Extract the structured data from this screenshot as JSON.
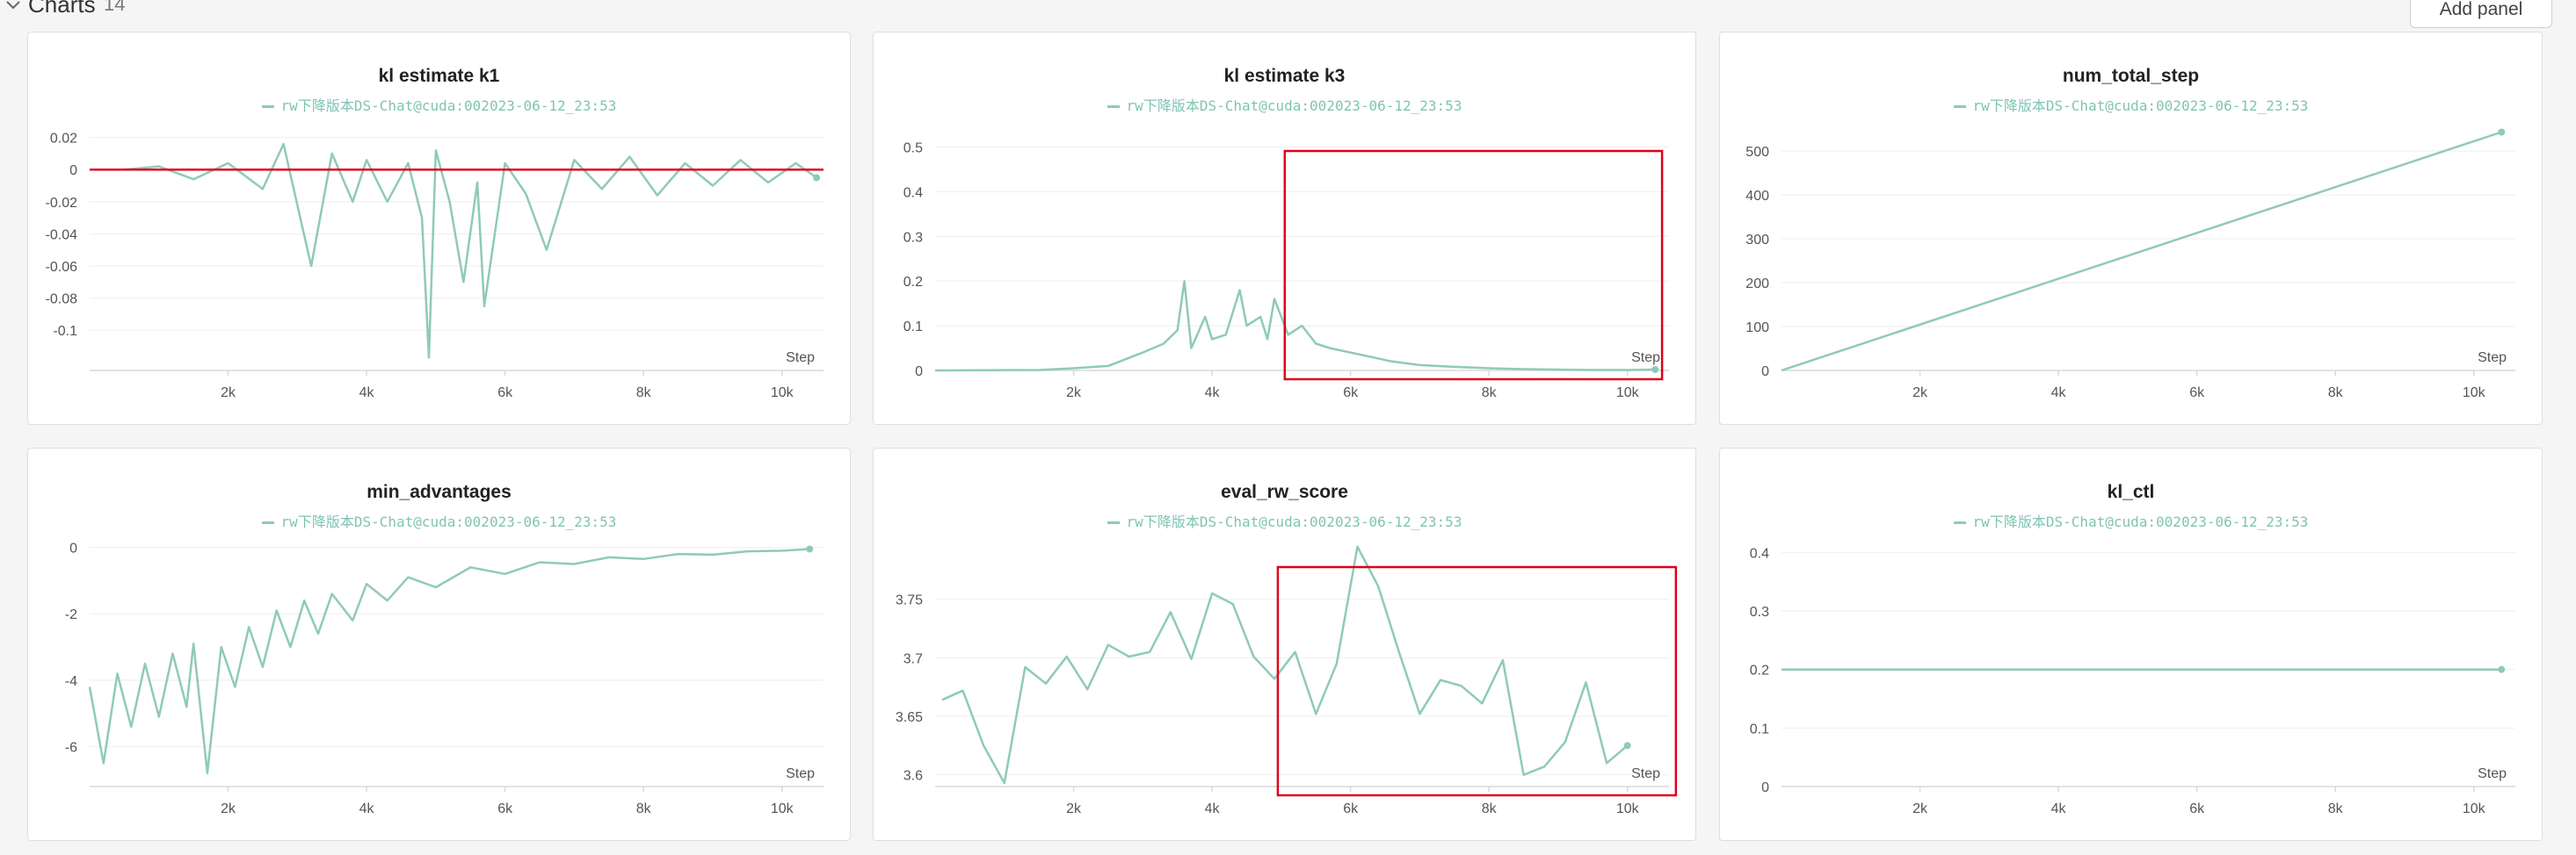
{
  "section": {
    "title": "Charts",
    "count": "14",
    "add_panel_label": "Add panel"
  },
  "legend_label": "rw下降版本DS-Chat@cuda:002023-06-12_23:53",
  "colors": {
    "series": "#8fcab9",
    "annotation_line": "#e0001b",
    "highlight_box": "#e0001b",
    "axis": "#d9d9d9",
    "tick_text": "#555555"
  },
  "chart_data": [
    {
      "id": "kl_k1",
      "type": "line",
      "title": "kl estimate k1",
      "series": [
        {
          "name": "rw下降版本DS-Chat@cuda:002023-06-12_23:53",
          "points": [
            [
              500,
              0
            ],
            [
              1000,
              0.002
            ],
            [
              1500,
              -0.006
            ],
            [
              2000,
              0.004
            ],
            [
              2500,
              -0.012
            ],
            [
              2800,
              0.016
            ],
            [
              3000,
              -0.022
            ],
            [
              3200,
              -0.06
            ],
            [
              3500,
              0.01
            ],
            [
              3800,
              -0.02
            ],
            [
              4000,
              0.006
            ],
            [
              4300,
              -0.02
            ],
            [
              4600,
              0.004
            ],
            [
              4800,
              -0.03
            ],
            [
              4900,
              -0.117
            ],
            [
              5000,
              0.012
            ],
            [
              5200,
              -0.02
            ],
            [
              5400,
              -0.07
            ],
            [
              5600,
              -0.008
            ],
            [
              5700,
              -0.085
            ],
            [
              6000,
              0.004
            ],
            [
              6300,
              -0.015
            ],
            [
              6600,
              -0.05
            ],
            [
              7000,
              0.006
            ],
            [
              7400,
              -0.012
            ],
            [
              7800,
              0.008
            ],
            [
              8200,
              -0.016
            ],
            [
              8600,
              0.004
            ],
            [
              9000,
              -0.01
            ],
            [
              9400,
              0.006
            ],
            [
              9800,
              -0.008
            ],
            [
              10200,
              0.004
            ],
            [
              10500,
              -0.005
            ]
          ]
        }
      ],
      "hline": 0,
      "xlabel": "Step",
      "xlim": [
        0,
        10600
      ],
      "ylim": [
        -0.125,
        0.028
      ],
      "xticks": [
        2000,
        4000,
        6000,
        8000,
        10000
      ],
      "xtick_labels": [
        "2k",
        "4k",
        "6k",
        "8k",
        "10k"
      ],
      "yticks": [
        0.02,
        0,
        -0.02,
        -0.04,
        -0.06,
        -0.08,
        -0.1
      ],
      "ytick_labels": [
        "0.02",
        "0",
        "-0.02",
        "-0.04",
        "-0.06",
        "-0.08",
        "-0.1"
      ],
      "grid": true,
      "legend": "top-center"
    },
    {
      "id": "kl_k3",
      "type": "line",
      "title": "kl estimate k3",
      "series": [
        {
          "name": "rw下降版本DS-Chat@cuda:002023-06-12_23:53",
          "points": [
            [
              0,
              0
            ],
            [
              1500,
              0.001
            ],
            [
              2000,
              0.005
            ],
            [
              2500,
              0.01
            ],
            [
              3000,
              0.04
            ],
            [
              3300,
              0.06
            ],
            [
              3500,
              0.09
            ],
            [
              3600,
              0.2
            ],
            [
              3700,
              0.05
            ],
            [
              3900,
              0.12
            ],
            [
              4000,
              0.07
            ],
            [
              4200,
              0.08
            ],
            [
              4400,
              0.18
            ],
            [
              4500,
              0.1
            ],
            [
              4700,
              0.12
            ],
            [
              4800,
              0.07
            ],
            [
              4900,
              0.16
            ],
            [
              5100,
              0.08
            ],
            [
              5300,
              0.1
            ],
            [
              5500,
              0.06
            ],
            [
              5700,
              0.05
            ],
            [
              6000,
              0.04
            ],
            [
              6300,
              0.03
            ],
            [
              6600,
              0.02
            ],
            [
              7000,
              0.012
            ],
            [
              7500,
              0.008
            ],
            [
              8000,
              0.005
            ],
            [
              8500,
              0.003
            ],
            [
              9000,
              0.002
            ],
            [
              9500,
              0.001
            ],
            [
              10000,
              0.001
            ],
            [
              10400,
              0.002
            ]
          ]
        }
      ],
      "xlabel": "Step",
      "xlim": [
        0,
        10600
      ],
      "ylim": [
        0,
        0.55
      ],
      "xticks": [
        2000,
        4000,
        6000,
        8000,
        10000
      ],
      "xtick_labels": [
        "2k",
        "4k",
        "6k",
        "8k",
        "10k"
      ],
      "yticks": [
        0,
        0.1,
        0.2,
        0.3,
        0.4,
        0.5
      ],
      "ytick_labels": [
        "0",
        "0.1",
        "0.2",
        "0.3",
        "0.4",
        "0.5"
      ],
      "highlight": {
        "x": [
          5050,
          10500
        ]
      },
      "grid": true,
      "legend": "top-center"
    },
    {
      "id": "num_total_step",
      "type": "line",
      "title": "num_total_step",
      "series": [
        {
          "name": "rw下降版本DS-Chat@cuda:002023-06-12_23:53",
          "points": [
            [
              0,
              0
            ],
            [
              10400,
              543
            ]
          ]
        }
      ],
      "xlabel": "Step",
      "xlim": [
        0,
        10600
      ],
      "ylim": [
        0,
        560
      ],
      "xticks": [
        2000,
        4000,
        6000,
        8000,
        10000
      ],
      "xtick_labels": [
        "2k",
        "4k",
        "6k",
        "8k",
        "10k"
      ],
      "yticks": [
        0,
        100,
        200,
        300,
        400,
        500
      ],
      "ytick_labels": [
        "0",
        "100",
        "200",
        "300",
        "400",
        "500"
      ],
      "grid": true,
      "legend": "top-center"
    },
    {
      "id": "min_advantages",
      "type": "line",
      "title": "min_advantages",
      "series": [
        {
          "name": "rw下降版本DS-Chat@cuda:002023-06-12_23:53",
          "points": [
            [
              0,
              -4.2
            ],
            [
              200,
              -6.5
            ],
            [
              400,
              -3.8
            ],
            [
              600,
              -5.4
            ],
            [
              800,
              -3.5
            ],
            [
              1000,
              -5.1
            ],
            [
              1200,
              -3.2
            ],
            [
              1400,
              -4.8
            ],
            [
              1500,
              -2.9
            ],
            [
              1700,
              -6.8
            ],
            [
              1900,
              -3.0
            ],
            [
              2100,
              -4.2
            ],
            [
              2300,
              -2.4
            ],
            [
              2500,
              -3.6
            ],
            [
              2700,
              -1.9
            ],
            [
              2900,
              -3.0
            ],
            [
              3100,
              -1.6
            ],
            [
              3300,
              -2.6
            ],
            [
              3500,
              -1.4
            ],
            [
              3800,
              -2.2
            ],
            [
              4000,
              -1.1
            ],
            [
              4300,
              -1.6
            ],
            [
              4600,
              -0.9
            ],
            [
              5000,
              -1.2
            ],
            [
              5500,
              -0.6
            ],
            [
              6000,
              -0.8
            ],
            [
              6500,
              -0.45
            ],
            [
              7000,
              -0.5
            ],
            [
              7500,
              -0.3
            ],
            [
              8000,
              -0.35
            ],
            [
              8500,
              -0.2
            ],
            [
              9000,
              -0.22
            ],
            [
              9500,
              -0.12
            ],
            [
              10000,
              -0.1
            ],
            [
              10400,
              -0.05
            ]
          ]
        }
      ],
      "xlabel": "Step",
      "xlim": [
        0,
        10600
      ],
      "ylim": [
        -7.2,
        0.2
      ],
      "xticks": [
        2000,
        4000,
        6000,
        8000,
        10000
      ],
      "xtick_labels": [
        "2k",
        "4k",
        "6k",
        "8k",
        "10k"
      ],
      "yticks": [
        0,
        -2,
        -4,
        -6
      ],
      "ytick_labels": [
        "0",
        "-2",
        "-4",
        "-6"
      ],
      "grid": true,
      "legend": "top-center"
    },
    {
      "id": "eval_rw_score",
      "type": "line",
      "title": "eval_rw_score",
      "series": [
        {
          "name": "rw下降版本DS-Chat@cuda:002023-06-12_23:53",
          "points": [
            [
              100,
              3.664
            ],
            [
              400,
              3.672
            ],
            [
              700,
              3.625
            ],
            [
              1000,
              3.593
            ],
            [
              1300,
              3.692
            ],
            [
              1600,
              3.678
            ],
            [
              1900,
              3.701
            ],
            [
              2200,
              3.673
            ],
            [
              2500,
              3.711
            ],
            [
              2800,
              3.701
            ],
            [
              3100,
              3.705
            ],
            [
              3400,
              3.739
            ],
            [
              3700,
              3.699
            ],
            [
              4000,
              3.755
            ],
            [
              4300,
              3.746
            ],
            [
              4600,
              3.701
            ],
            [
              4900,
              3.682
            ],
            [
              5200,
              3.705
            ],
            [
              5500,
              3.652
            ],
            [
              5800,
              3.695
            ],
            [
              6100,
              3.795
            ],
            [
              6400,
              3.761
            ],
            [
              6700,
              3.705
            ],
            [
              7000,
              3.652
            ],
            [
              7300,
              3.681
            ],
            [
              7600,
              3.676
            ],
            [
              7900,
              3.661
            ],
            [
              8200,
              3.698
            ],
            [
              8500,
              3.6
            ],
            [
              8800,
              3.607
            ],
            [
              9100,
              3.628
            ],
            [
              9400,
              3.679
            ],
            [
              9700,
              3.61
            ],
            [
              10000,
              3.625
            ]
          ]
        }
      ],
      "xlabel": "Step",
      "xlim": [
        0,
        10600
      ],
      "ylim": [
        3.59,
        3.8
      ],
      "xticks": [
        2000,
        4000,
        6000,
        8000,
        10000
      ],
      "xtick_labels": [
        "2k",
        "4k",
        "6k",
        "8k",
        "10k"
      ],
      "yticks": [
        3.6,
        3.65,
        3.7,
        3.75
      ],
      "ytick_labels": [
        "3.6",
        "3.65",
        "3.7",
        "3.75"
      ],
      "highlight": {
        "x": [
          4950,
          10700
        ]
      },
      "grid": true,
      "legend": "top-center"
    },
    {
      "id": "kl_ctl",
      "type": "line",
      "title": "kl_ctl",
      "series": [
        {
          "name": "rw下降版本DS-Chat@cuda:002023-06-12_23:53",
          "points": [
            [
              0,
              0.2
            ],
            [
              10400,
              0.2
            ]
          ]
        }
      ],
      "xlabel": "Step",
      "xlim": [
        0,
        10600
      ],
      "ylim": [
        0,
        0.42
      ],
      "xticks": [
        2000,
        4000,
        6000,
        8000,
        10000
      ],
      "xtick_labels": [
        "2k",
        "4k",
        "6k",
        "8k",
        "10k"
      ],
      "yticks": [
        0,
        0.1,
        0.2,
        0.3,
        0.4
      ],
      "ytick_labels": [
        "0",
        "0.1",
        "0.2",
        "0.3",
        "0.4"
      ],
      "grid": true,
      "legend": "top-center"
    }
  ]
}
